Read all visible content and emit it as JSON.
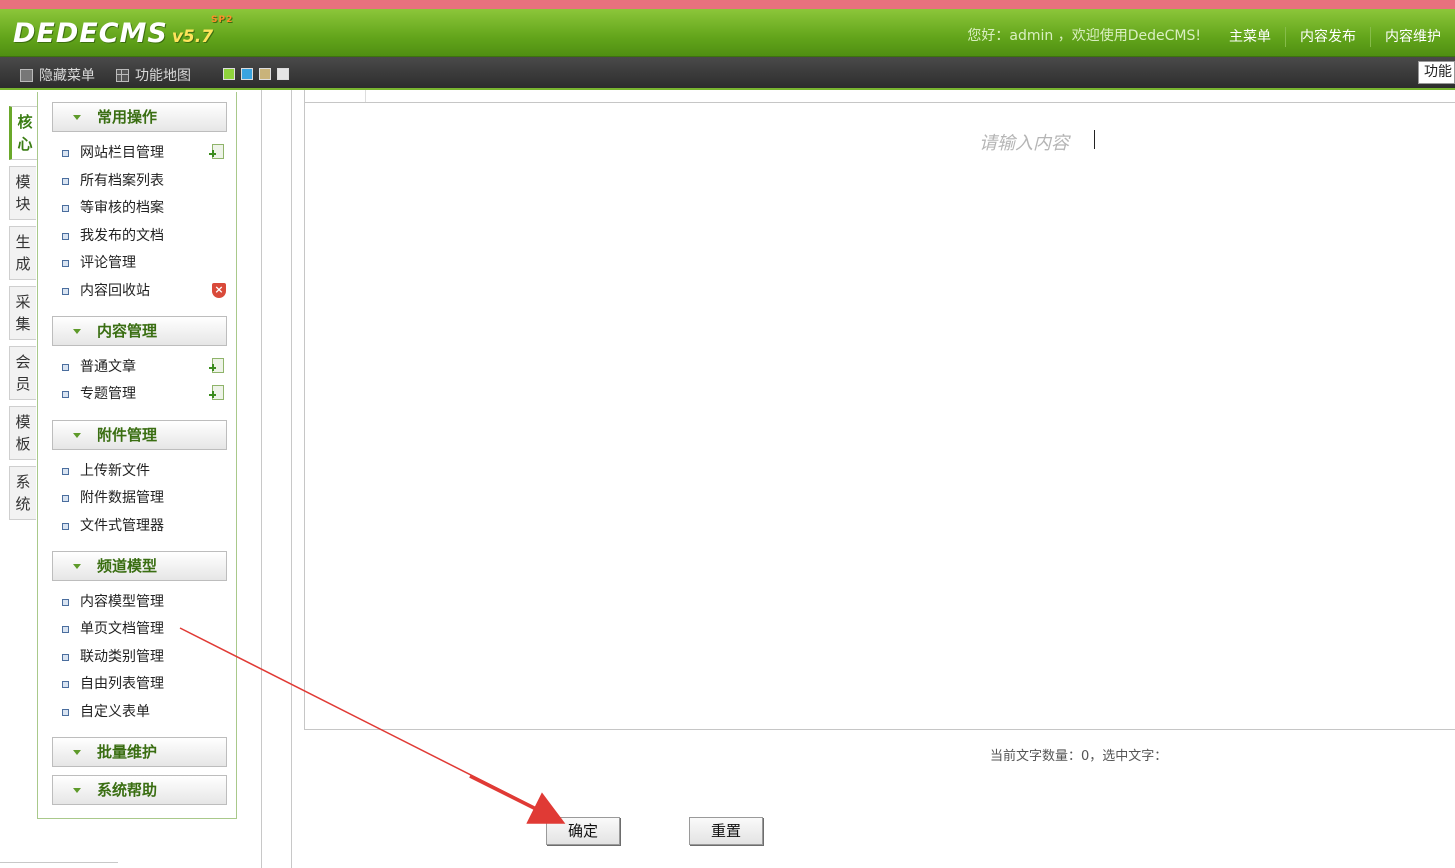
{
  "header": {
    "logo_text": "DEDECMS",
    "logo_version": "v5.7",
    "logo_sub": "SP2",
    "welcome": "您好：admin ，欢迎使用DedeCMS!",
    "nav": [
      "主菜单",
      "内容发布",
      "内容维护"
    ]
  },
  "toolbar": {
    "hide_menu": "隐藏菜单",
    "sitemap": "功能地图",
    "skin_colors": [
      "#8fd33c",
      "#3aa4e0",
      "#c9b37a",
      "#e5e5e5"
    ],
    "func_box": "功能"
  },
  "vtabs": [
    {
      "top": "核",
      "bottom": "心"
    },
    {
      "top": "模",
      "bottom": "块"
    },
    {
      "top": "生",
      "bottom": "成"
    },
    {
      "top": "采",
      "bottom": "集"
    },
    {
      "top": "会",
      "bottom": "员"
    },
    {
      "top": "模",
      "bottom": "板"
    },
    {
      "top": "系",
      "bottom": "统"
    }
  ],
  "menu": {
    "sections": [
      "常用操作",
      "内容管理",
      "附件管理",
      "频道模型",
      "批量维护",
      "系统帮助"
    ],
    "items": [
      "网站栏目管理",
      "所有档案列表",
      "等审核的档案",
      "我发布的文档",
      "评论管理",
      "内容回收站",
      "普通文章",
      "专题管理",
      "上传新文件",
      "附件数据管理",
      "文件式管理器",
      "内容模型管理",
      "单页文档管理",
      "联动类别管理",
      "自由列表管理",
      "自定义表单"
    ],
    "delete_mark": "×"
  },
  "editor": {
    "placeholder": "请输入内容",
    "wordcount": "当前文字数量：0，选中文字："
  },
  "buttons": {
    "confirm": "确定",
    "reset": "重置"
  },
  "colors": {
    "header_green": "#63a51b",
    "toolbar_dark": "#2d2d2d",
    "section_text": "#3a6e12",
    "arrow_red": "#e03a35"
  }
}
